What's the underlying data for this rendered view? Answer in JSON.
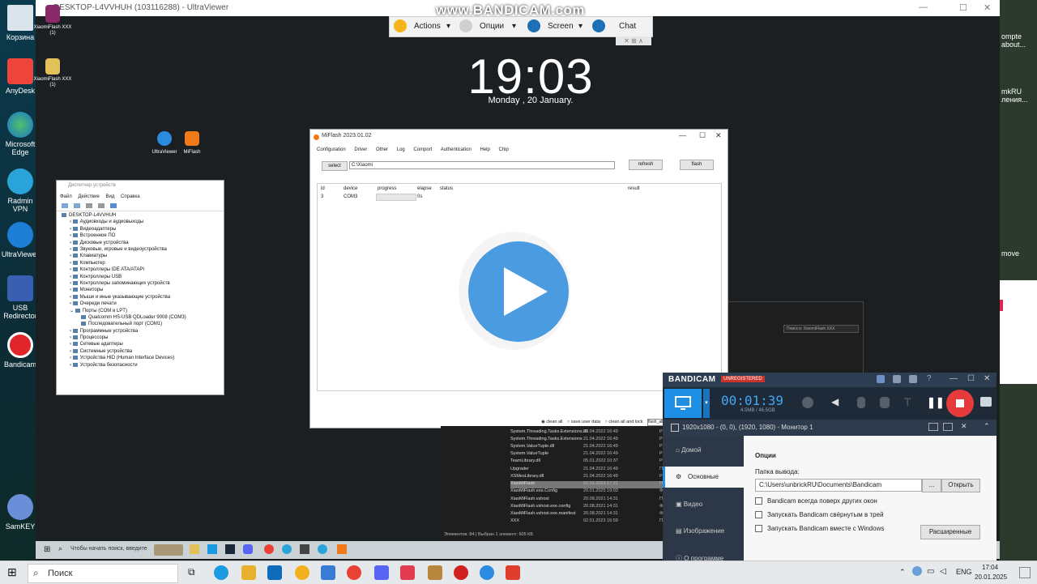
{
  "watermark": "www.BANDICAM.com",
  "host_desktop": {
    "icons": [
      {
        "label": "Корзина"
      },
      {
        "label": "AnyDesk"
      },
      {
        "label": "Microsoft Edge"
      },
      {
        "label": "Radmin VPN"
      },
      {
        "label": "UltraViewer"
      },
      {
        "label": "USB Redirector"
      },
      {
        "label": "Bandicam"
      },
      {
        "label": "SamKEY"
      }
    ],
    "right_fragments": [
      "ompte",
      "about...",
      "mkRU",
      "ления...",
      "move"
    ]
  },
  "ultraviewer": {
    "title": "DESKTOP-L4VVHUH (103116288) - UltraViewer",
    "toolbar": {
      "actions": "Actions",
      "options": "Опции",
      "screen": "Screen",
      "chat": "Chat"
    }
  },
  "remote_desktop": {
    "clock": "19:03",
    "date": "Monday , 20 January.",
    "icons": [
      {
        "label": "XiaomiFlash XXX (1)"
      },
      {
        "label": "XiaomiFlash XXX (1)"
      },
      {
        "label": "UltraViewer"
      },
      {
        "label": "MiFlash"
      }
    ],
    "search_placeholder": "Чтобы начать поиск, введите"
  },
  "miflash": {
    "title": "MiFlash 2023.01.02",
    "menu": [
      "Configuration",
      "Driver",
      "Other",
      "Log",
      "Comport",
      "Authentication",
      "Help",
      "Chip"
    ],
    "select_button": "select",
    "path_value": "C:\\Xiaomi",
    "refresh_button": "refresh",
    "flash_button": "flash",
    "columns": [
      "id",
      "device",
      "progress",
      "elapse",
      "status",
      "result"
    ],
    "rows": [
      {
        "id": "3",
        "device": "COM3",
        "elapse": "0s"
      }
    ],
    "options": [
      "clean all",
      "save user data",
      "clean all and lock"
    ],
    "script_value": "flash_all"
  },
  "device_manager": {
    "title": "Диспетчер устройств",
    "menu": [
      "Файл",
      "Действие",
      "Вид",
      "Справка"
    ],
    "tree": [
      "DESKTOP-L4VVHUH",
      "Аудиовходы и аудиовыходы",
      "Видеоадаптеры",
      "Встроенное ПО",
      "Дисковые устройства",
      "Звуковые, игровые и видеоустройства",
      "Клавиатуры",
      "Компьютер",
      "Контроллеры IDE ATA/ATAPI",
      "Контроллеры USB",
      "Контроллеры запоминающих устройств",
      "Мониторы",
      "Мыши и иные указывающие устройства",
      "Очереди печати",
      "Порты (COM и LPT)",
      "Qualcomm HS-USB QDLoader 9008 (COM3)",
      "Последовательный порт (COM1)",
      "Программные устройства",
      "Процессоры",
      "Сетевые адаптеры",
      "Системные устройства",
      "Устройства HID (Human Interface Devices)",
      "Устройства безопасности"
    ]
  },
  "explorer": {
    "search_placeholder": "Поиск в: XiaomiFlash XXX",
    "files": [
      {
        "name": "System.Threading.Tasks.Extensions.dll",
        "date": "21.04.2022 16:49",
        "type": "Р"
      },
      {
        "name": "System.Threading.Tasks.Extensions",
        "date": "21.04.2022 16:49",
        "type": "Р"
      },
      {
        "name": "System.ValueTuple.dll",
        "date": "21.04.2022 16:49",
        "type": "Р"
      },
      {
        "name": "System.ValueTuple",
        "date": "21.04.2022 16:49",
        "type": "Р"
      },
      {
        "name": "TeamLibrary.dll",
        "date": "05.01.2022 10:37",
        "type": "Р"
      },
      {
        "name": "Upgrader",
        "date": "21.04.2022 16:49",
        "type": "П"
      },
      {
        "name": "XSMesLibrary.dll",
        "date": "21.04.2022 16:49",
        "type": "Р"
      },
      {
        "name": "XiaoMiFlash",
        "date": "02.01.2023 17:21",
        "type": "П"
      },
      {
        "name": "XiaoMiFlash.exe.Config",
        "date": "20.01.2025 19:03",
        "type": "Ф"
      },
      {
        "name": "XiaoMiFlash.vshost",
        "date": "20.08.2021 14:31",
        "type": "П"
      },
      {
        "name": "XiaoMiFlash.vshost.exe.config",
        "date": "20.08.2021 14:31",
        "type": "Ф"
      },
      {
        "name": "XiaoMiFlash.vshost.exe.manifest",
        "date": "20.08.2021 14:31",
        "type": "Ф"
      },
      {
        "name": "XXX",
        "date": "02.01.2023 16:59",
        "type": "П"
      }
    ],
    "status": "Элементов: 84  |  Выбран 1 элемент: 605 КБ"
  },
  "bandicam": {
    "brand": "BANDICAM",
    "badge": "UNREGISTERED",
    "timer": "00:01:39",
    "size": "4.5MB / 46.5GB",
    "source": "1920x1080 - (0, 0), (1920, 1080) - Монитор 1",
    "nav": [
      "Домой",
      "Основные",
      "Видео",
      "Изображение",
      "О программе"
    ],
    "section_title": "Опции",
    "output_label": "Папка вывода:",
    "output_path": "C:\\Users\\unbrickRU\\Documents\\Bandicam",
    "browse_button": "...",
    "open_button": "Открыть",
    "checks": [
      "Bandicam всегда поверх других окон",
      "Запускать Bandicam свёрнутым в трей",
      "Запускать Bandicam вместе с Windows"
    ],
    "advanced_button": "Расширенные",
    "colors": {
      "accent": "#1f8fe6",
      "record": "#e63b3b"
    }
  },
  "host_taskbar": {
    "search": "Поиск",
    "lang": "ENG",
    "time": "17:04",
    "date": "20.01.2025"
  }
}
